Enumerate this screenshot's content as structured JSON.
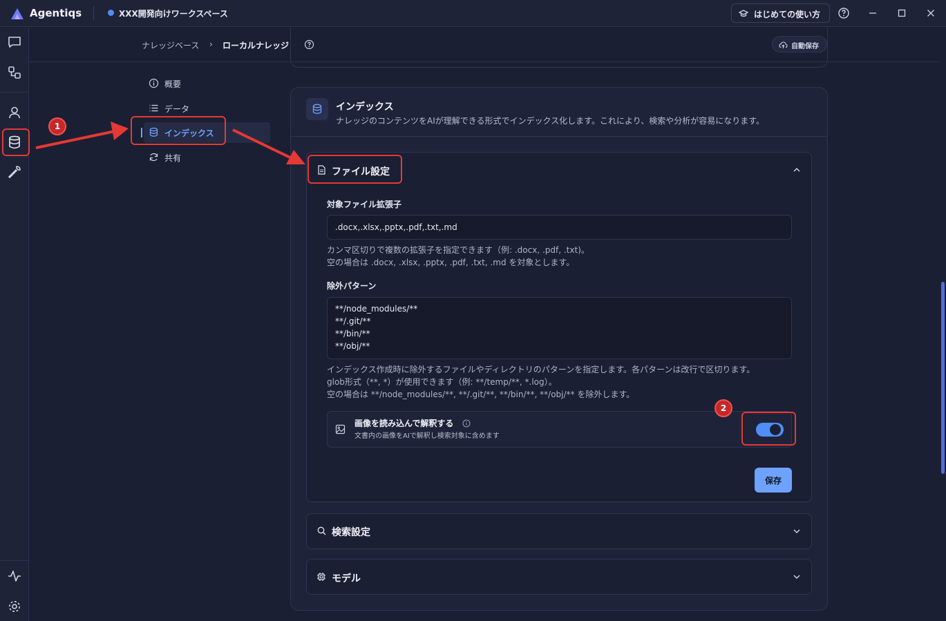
{
  "titlebar": {
    "app_name": "Agentiqs",
    "workspace": "XXX開発向けワークスペース",
    "guide_label": "はじめての使い方"
  },
  "breadcrumb": {
    "parent": "ナレッジベース",
    "separator": "›",
    "current": "ローカルナレッジ"
  },
  "autosave_label": "自動保存",
  "nav": {
    "items": [
      {
        "label": "概要",
        "icon": "info-icon"
      },
      {
        "label": "データ",
        "icon": "list-icon"
      },
      {
        "label": "インデックス",
        "icon": "database-icon",
        "active": true
      },
      {
        "label": "共有",
        "icon": "refresh-icon"
      }
    ]
  },
  "card": {
    "title": "インデックス",
    "description": "ナレッジのコンテンツをAIが理解できる形式でインデックス化します。これにより、検索や分析が容易になります。"
  },
  "file_settings": {
    "title": "ファイル設定",
    "extensions_label": "対象ファイル拡張子",
    "extensions_value": ".docx,.xlsx,.pptx,.pdf,.txt,.md",
    "extensions_help_1": "カンマ区切りで複数の拡張子を指定できます（例: .docx, .pdf, .txt)。",
    "extensions_help_2": "空の場合は .docx, .xlsx, .pptx, .pdf, .txt, .md を対象とします。",
    "exclude_label": "除外パターン",
    "exclude_value": "**/node_modules/**\n**/.git/**\n**/bin/**\n**/obj/**",
    "exclude_help_1": "インデックス作成時に除外するファイルやディレクトリのパターンを指定します。各パターンは改行で区切ります。",
    "exclude_help_2": "glob形式（**, *）が使用できます（例: **/temp/**, *.log）。",
    "exclude_help_3": "空の場合は **/node_modules/**, **/.git/**, **/bin/**, **/obj/** を除外します。",
    "image_toggle_title": "画像を読み込んで解釈する",
    "image_toggle_desc": "文書内の画像をAIで解釈し検索対象に含めます",
    "image_toggle_on": true,
    "save_label": "保存"
  },
  "search_settings": {
    "title": "検索設定"
  },
  "model_settings": {
    "title": "モデル"
  },
  "annotations": {
    "badge_1": "1",
    "badge_2": "2"
  },
  "colors": {
    "accent": "#6ea2ff",
    "toggle_on": "#4f8ef7",
    "annotation_red": "#e53935",
    "background": "#1b1f33"
  }
}
